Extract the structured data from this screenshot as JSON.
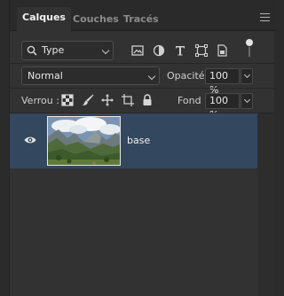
{
  "tabs": [
    {
      "label": "Calques",
      "active": true
    },
    {
      "label": "Couches",
      "active": false
    },
    {
      "label": "Tracés",
      "active": false
    }
  ],
  "filter": {
    "kind_label": "Type",
    "icons": [
      "image-filter-icon",
      "adjustment-filter-icon",
      "text-filter-icon",
      "shape-filter-icon",
      "smart-object-filter-icon"
    ]
  },
  "blend": {
    "mode": "Normal",
    "opacity_label": "Opacité :",
    "opacity_value": "100 %"
  },
  "lock": {
    "label": "Verrou :",
    "icons": [
      "lock-transparent-pixels-icon",
      "lock-image-pixels-icon",
      "lock-position-icon",
      "lock-artboard-icon",
      "lock-all-icon"
    ],
    "fill_label": "Fond :",
    "fill_value": "100 %"
  },
  "layers": [
    {
      "name": "base",
      "visible": true,
      "selected": true
    }
  ],
  "colors": {
    "panel_bg": "#323232",
    "tab_bar_bg": "#2a2a2a",
    "selected_layer": "#33475e"
  }
}
